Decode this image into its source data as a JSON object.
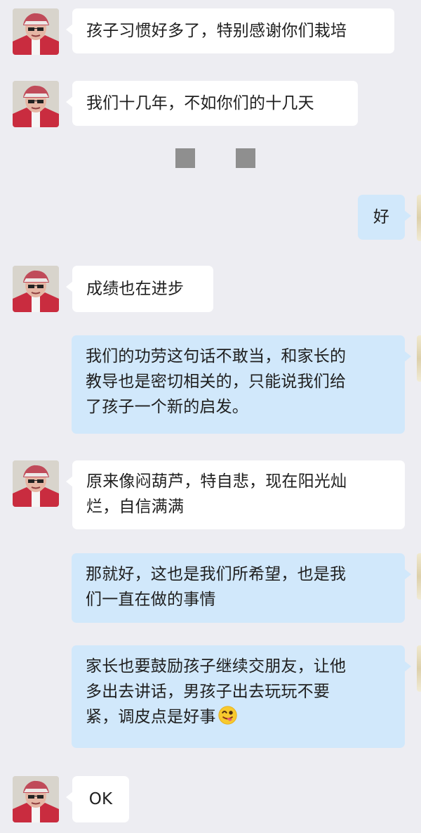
{
  "messages": [
    {
      "side": "left",
      "text": "孩子习惯好多了，特别感谢你们栽培"
    },
    {
      "side": "left",
      "text": "我们十几年，不如你们的十几天"
    },
    {
      "side": "right",
      "text": "好"
    },
    {
      "side": "left",
      "text": "成绩也在进步"
    },
    {
      "side": "right",
      "lines": [
        "我们的功劳这句话不敢当，和家长的",
        "教导也是密切相关的，只能说我们给",
        "了孩子一个新的启发。"
      ]
    },
    {
      "side": "left",
      "lines": [
        "原来像闷葫芦，特自悲，现在阳光灿",
        "烂，自信满满"
      ]
    },
    {
      "side": "right",
      "lines": [
        "那就好，这也是我们所希望，也是我",
        "们一直在做的事情"
      ]
    },
    {
      "side": "right",
      "lines": [
        "家长也要鼓励孩子继续交朋友，让他",
        "多出去讲话，男孩子出去玩玩不要",
        "紧，调皮点是好事"
      ],
      "emoji": "winking-tongue-emoji"
    },
    {
      "side": "left",
      "text": "OK"
    }
  ],
  "colors": {
    "background": "#ededf2",
    "left_bubble": "#ffffff",
    "right_bubble": "#d1e8fb",
    "placeholder_square": "#8f8f8f"
  }
}
